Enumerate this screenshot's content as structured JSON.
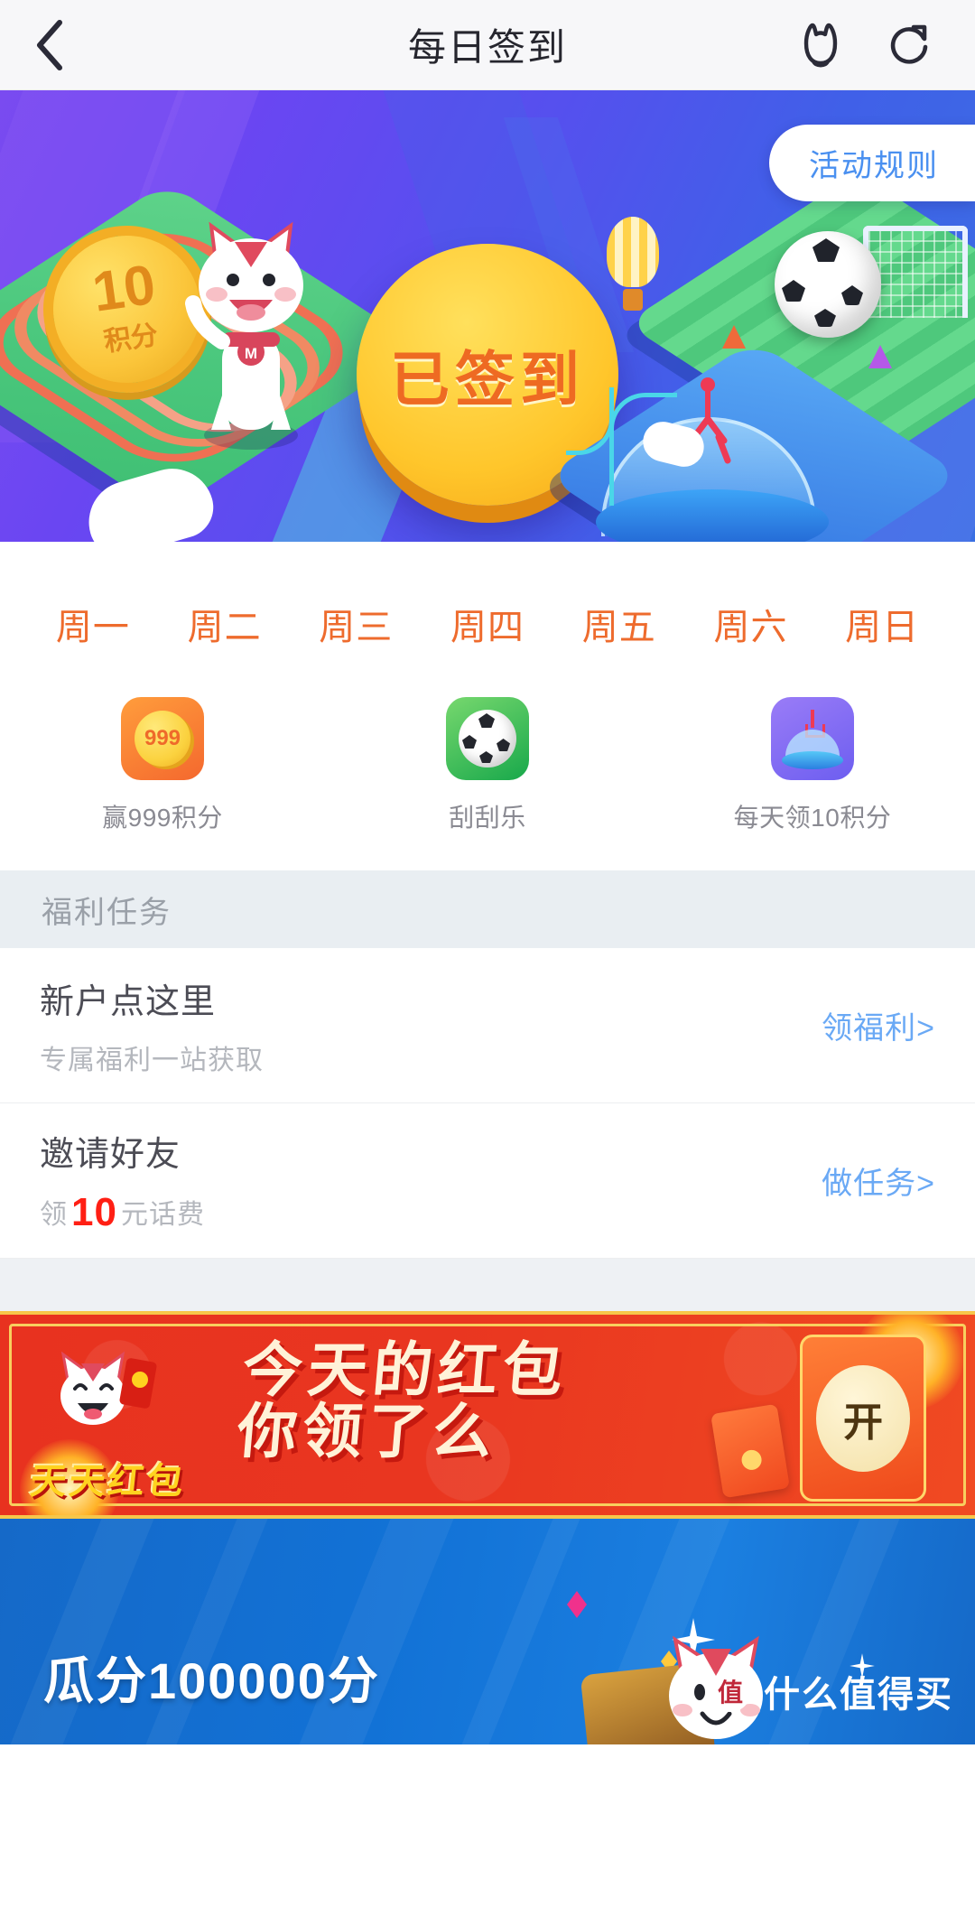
{
  "header": {
    "title": "每日签到",
    "back_icon": "chevron-left-icon",
    "cat_icon": "cat-face-icon",
    "refresh_icon": "refresh-icon"
  },
  "banner": {
    "rules_button": "活动规则",
    "sign_button": "已签到",
    "trophy_points_number": "10",
    "trophy_points_unit": "积分",
    "accent_gold": "#ffc62b",
    "accent_orange": "#ee6a22",
    "bg_from": "#7a4bf0",
    "bg_to": "#3a6fe2"
  },
  "weekdays": [
    {
      "label": "周一"
    },
    {
      "label": "周二"
    },
    {
      "label": "周三"
    },
    {
      "label": "周四"
    },
    {
      "label": "周五"
    },
    {
      "label": "周六"
    },
    {
      "label": "周日"
    }
  ],
  "weekday_color": "#ee6b2d",
  "apps": [
    {
      "label": "赢999积分",
      "icon": "coin-999-icon",
      "coin_text": "999",
      "color": "#f4682e"
    },
    {
      "label": "刮刮乐",
      "icon": "soccer-ball-icon",
      "color": "#18a84b"
    },
    {
      "label": "每天领10积分",
      "icon": "claw-machine-icon",
      "color": "#6d5ef0"
    }
  ],
  "welfare": {
    "section_title": "福利任务",
    "tasks": [
      {
        "title": "新户点这里",
        "subtitle": "专属福利一站获取",
        "action": "领福利>"
      },
      {
        "title": "邀请好友",
        "sub_prefix": "领",
        "sub_highlight": "10",
        "sub_suffix": "元话费",
        "action": "做任务>"
      }
    ],
    "link_color": "#6aa9f5",
    "highlight_color": "#ff1f14"
  },
  "red_banner": {
    "badge": "天天红包",
    "headline_line1": "今天的红包",
    "headline_line2": "你领了么",
    "open_button": "开",
    "bg_color": "#e8321f",
    "border_color": "#f7c64a"
  },
  "blue_banner": {
    "title": "瓜分100000分",
    "bg_color": "#1272d6",
    "watermark_logo": "值",
    "watermark_text": "什么值得买"
  }
}
